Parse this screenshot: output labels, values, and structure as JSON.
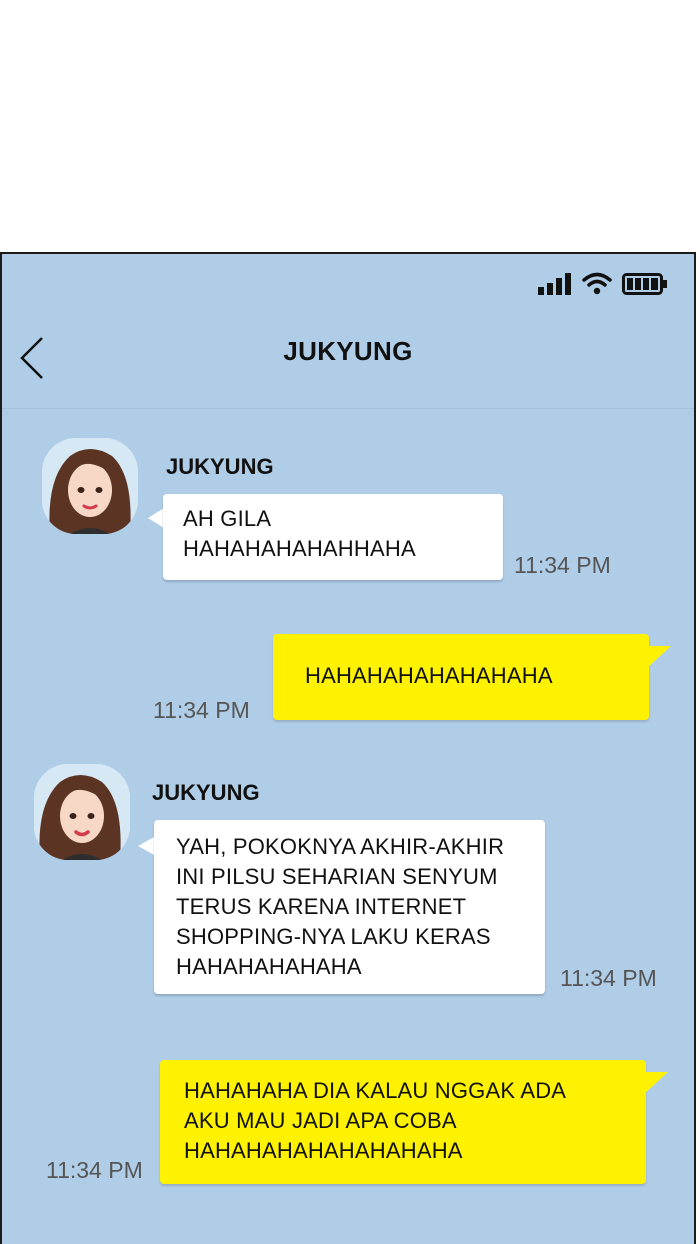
{
  "header": {
    "title": "JUKYUNG",
    "back_icon": "chevron-left-icon"
  },
  "status_bar": {
    "icons": [
      "signal-icon",
      "wifi-icon",
      "battery-icon"
    ]
  },
  "colors": {
    "background": "#b0cde8",
    "incoming_bubble": "#ffffff",
    "outgoing_bubble": "#fef200"
  },
  "messages": [
    {
      "sender": "JUKYUNG",
      "direction": "incoming",
      "text": "AH GILA\nHAHAHAHAHAHHAHA",
      "time": "11:34 PM"
    },
    {
      "direction": "outgoing",
      "text": "HAHAHAHAHAHAHAHA",
      "time": "11:34 PM"
    },
    {
      "sender": "JUKYUNG",
      "direction": "incoming",
      "text": "YAH, POKOKNYA AKHIR-AKHIR\nINI PILSU SEHARIAN SENYUM\nTERUS KARENA INTERNET\nSHOPPING-NYA LAKU KERAS\nHAHAHAHAHAHA",
      "time": "11:34 PM"
    },
    {
      "direction": "outgoing",
      "text": "HAHAHAHA DIA KALAU NGGAK ADA\nAKU MAU JADI APA COBA\nHAHAHAHAHAHAHAHAHA",
      "time": "11:34 PM"
    }
  ]
}
